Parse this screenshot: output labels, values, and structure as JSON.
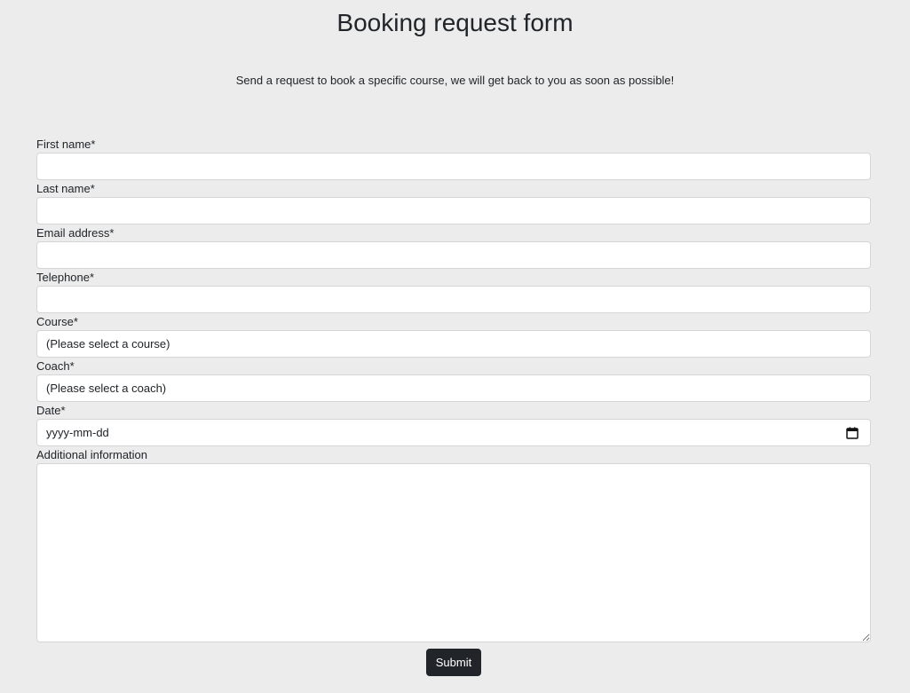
{
  "header": {
    "title": "Booking request form",
    "subtitle": "Send a request to book a specific course, we will get back to you as soon as possible!"
  },
  "form": {
    "first_name": {
      "label": "First name*",
      "value": ""
    },
    "last_name": {
      "label": "Last name*",
      "value": ""
    },
    "email": {
      "label": "Email address*",
      "value": ""
    },
    "telephone": {
      "label": "Telephone*",
      "value": ""
    },
    "course": {
      "label": "Course*",
      "selected": "(Please select a course)"
    },
    "coach": {
      "label": "Coach*",
      "selected": "(Please select a coach)"
    },
    "date": {
      "label": "Date*",
      "placeholder": "yyyy-mm-dd",
      "icon": "calendar-icon"
    },
    "additional": {
      "label": "Additional information",
      "value": ""
    },
    "submit_label": "Submit"
  },
  "colors": {
    "background": "#ececec",
    "submit_background": "#212529",
    "field_border": "#d3d5d8"
  }
}
